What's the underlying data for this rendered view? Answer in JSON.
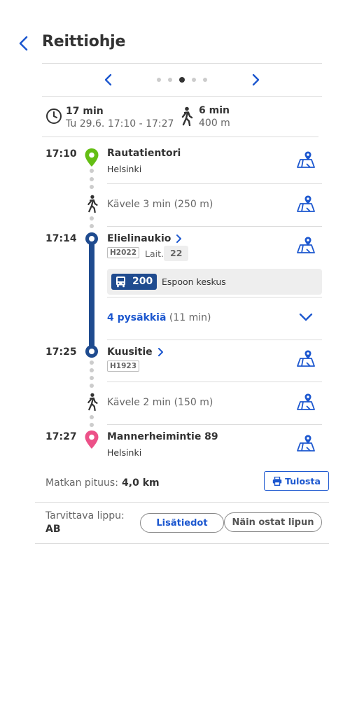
{
  "header": {
    "title": "Reittiohje"
  },
  "pager": {
    "count": 5,
    "active_index": 2
  },
  "summary": {
    "duration": "17 min",
    "date_time": "Tu 29.6. 17:10 - 17:27",
    "walk_duration": "6 min",
    "walk_distance": "400 m"
  },
  "legs": {
    "origin": {
      "time": "17:10",
      "name": "Rautatientori",
      "city": "Helsinki"
    },
    "walk1": {
      "text": "Kävele 3 min (250 m)"
    },
    "board": {
      "time": "17:14",
      "name": "Elielinaukio",
      "code": "H2022",
      "platform_label": "Lait.",
      "platform": "22"
    },
    "route": {
      "number": "200",
      "headsign": "Espoon keskus"
    },
    "intermediate": {
      "count_text": "4 pysäkkiä",
      "duration_text": "(11 min)"
    },
    "alight": {
      "time": "17:25",
      "name": "Kuusitie",
      "code": "H1923"
    },
    "walk2": {
      "text": "Kävele 2 min (150 m)"
    },
    "destination": {
      "time": "17:27",
      "name": "Mannerheimintie 89",
      "city": "Helsinki"
    }
  },
  "footer": {
    "distance_label": "Matkan pituus:",
    "distance_value": "4,0 km",
    "print_label": "Tulosta",
    "ticket_label": "Tarvittava lippu:",
    "ticket_value": "AB",
    "more_info_label": "Lisätiedot",
    "buy_label": "Näin ostat lipun"
  },
  "colors": {
    "accent": "#1c57cf",
    "origin_marker": "#64be14",
    "destination_marker": "#ec5188",
    "bus": "#1f4b8f"
  }
}
